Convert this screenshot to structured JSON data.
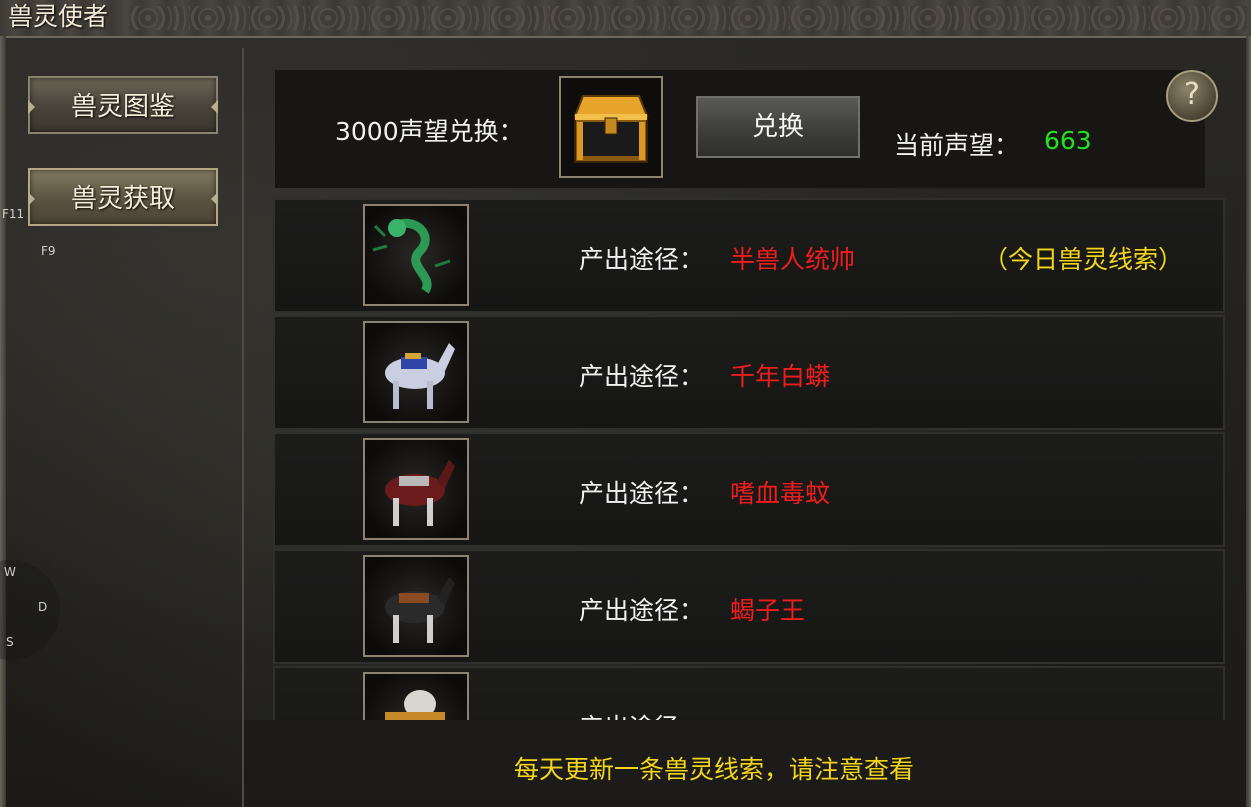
{
  "window": {
    "title": "兽灵使者"
  },
  "sidebar": {
    "items": [
      {
        "label": "兽灵图鉴"
      },
      {
        "label": "兽灵获取"
      }
    ]
  },
  "hotkeys": {
    "f11": "F11",
    "f9": "F9",
    "w": "W",
    "d": "D",
    "s": "S"
  },
  "exchange": {
    "cost_label": "3000声望兑换：",
    "reward_icon": "treasure-chest-icon",
    "button_label": "兑换",
    "reputation_label": "当前声望：",
    "reputation_value": "663",
    "help_symbol": "?"
  },
  "rows": [
    {
      "icon": "green-dragon-icon",
      "label": "产出途径：",
      "source": "半兽人统帅",
      "clue": "（今日兽灵线索）"
    },
    {
      "icon": "white-horse-mount-icon",
      "label": "产出途径：",
      "source": "千年白蟒",
      "clue": ""
    },
    {
      "icon": "red-armored-horse-icon",
      "label": "产出途径：",
      "source": "嗜血毒蚊",
      "clue": ""
    },
    {
      "icon": "black-armored-horse-icon",
      "label": "产出途径：",
      "source": "蝎子王",
      "clue": ""
    },
    {
      "icon": "white-beast-icon",
      "label": "产出途径：",
      "source": "",
      "clue": ""
    }
  ],
  "footer": {
    "notice": "每天更新一条兽灵线索，请注意查看"
  },
  "colors": {
    "source_text": "#f01d1d",
    "clue_text": "#f3d61a",
    "reputation_value": "#22e022"
  }
}
